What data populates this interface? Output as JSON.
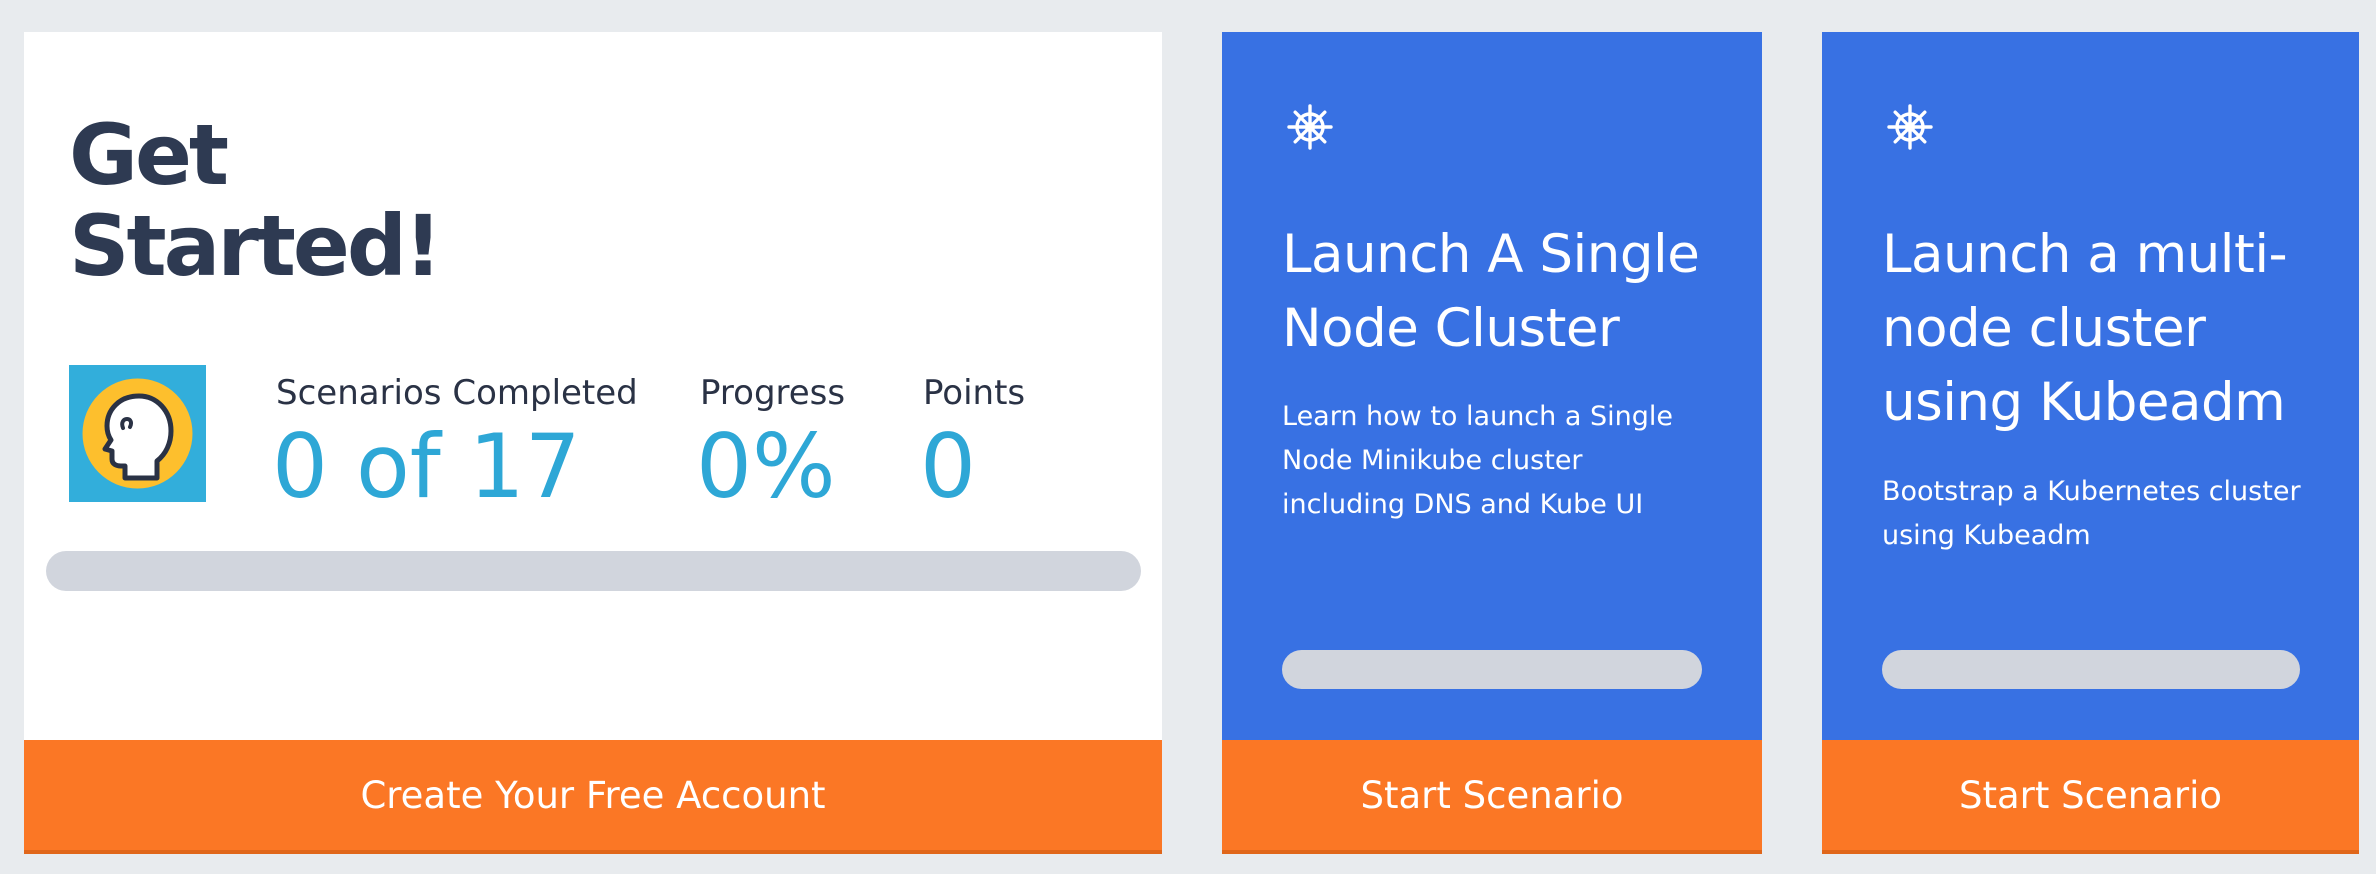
{
  "colors": {
    "background": "#e8ebee",
    "card_blue": "#3871e3",
    "cta_orange": "#fb7725",
    "title_dark": "#2e3a52",
    "stat_blue": "#2ea7d6",
    "track_gray": "#d1d5dd",
    "avatar_blue": "#32aedb",
    "avatar_yellow": "#fdbf2d"
  },
  "get_started": {
    "title": "Get Started!",
    "avatar_icon": "head-profile-icon",
    "stats": [
      {
        "label": "Scenarios Completed",
        "value": "0 of 17"
      },
      {
        "label": "Progress",
        "value": "0%"
      },
      {
        "label": "Points",
        "value": "0"
      }
    ],
    "progress_fraction": 0,
    "cta_label": "Create Your Free Account"
  },
  "scenarios": [
    {
      "icon": "kubernetes-helm-icon",
      "title": "Launch A Single Node Cluster",
      "description": "Learn how to launch a Single Node Minikube cluster including DNS and Kube UI",
      "progress_fraction": 0,
      "cta_label": "Start Scenario"
    },
    {
      "icon": "kubernetes-helm-icon",
      "title": "Launch a multi-node cluster using Kubeadm",
      "description": "Bootstrap a Kubernetes cluster using Kubeadm",
      "progress_fraction": 0,
      "cta_label": "Start Scenario"
    }
  ]
}
